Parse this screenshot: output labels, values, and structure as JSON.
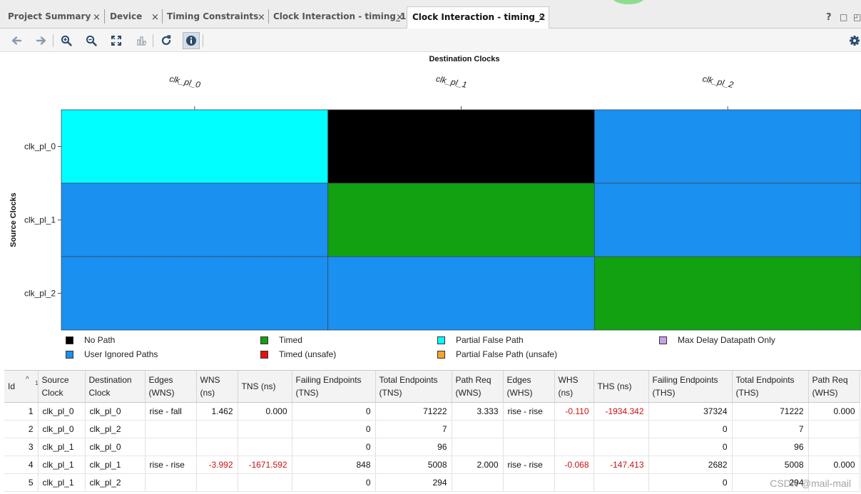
{
  "tabs": [
    {
      "label": "Project Summary",
      "active": false
    },
    {
      "label": "Device",
      "active": false
    },
    {
      "label": "Timing Constraints",
      "active": false
    },
    {
      "label": "Clock Interaction - timing_1",
      "active": false
    },
    {
      "label": "Clock Interaction - timing_2",
      "active": true
    }
  ],
  "tab_close_glyph": "×",
  "window_controls": {
    "help": "?",
    "restore": "□",
    "maximize": "◰"
  },
  "toolbar": {
    "buttons": [
      "back-icon",
      "forward-icon",
      "zoom-in-icon",
      "zoom-out-icon",
      "fit-icon",
      "chart-icon",
      "refresh-icon",
      "info-icon"
    ],
    "settings_icon": "gear-icon"
  },
  "chart_data": {
    "type": "heatmap",
    "title": "Destination Clocks",
    "xlabel": "Destination Clocks",
    "ylabel": "Source Clocks",
    "x_categories": [
      "clk_pl_0",
      "clk_pl_1",
      "clk_pl_2"
    ],
    "y_categories": [
      "clk_pl_0",
      "clk_pl_1",
      "clk_pl_2"
    ],
    "cells": [
      [
        "Partial False Path",
        "No Path",
        "User Ignored Paths"
      ],
      [
        "User Ignored Paths",
        "Timed",
        "User Ignored Paths"
      ],
      [
        "User Ignored Paths",
        "User Ignored Paths",
        "Timed"
      ]
    ],
    "legend": [
      {
        "label": "No Path",
        "color": "#000000"
      },
      {
        "label": "Timed",
        "color": "#11a111"
      },
      {
        "label": "Partial False Path",
        "color": "#00ffff"
      },
      {
        "label": "Max Delay Datapath Only",
        "color": "#c8a0e8"
      },
      {
        "label": "User Ignored Paths",
        "color": "#1a90f0"
      },
      {
        "label": "Timed (unsafe)",
        "color": "#e81010"
      },
      {
        "label": "Partial False Path (unsafe)",
        "color": "#f7a42a"
      }
    ],
    "legend_placement": "bottom"
  },
  "table": {
    "columns": [
      [
        "Id",
        ""
      ],
      [
        "Source",
        "Clock"
      ],
      [
        "Destination",
        "Clock"
      ],
      [
        "Edges",
        "(WNS)"
      ],
      [
        "WNS",
        "(ns)"
      ],
      [
        "TNS (ns)",
        ""
      ],
      [
        "Failing Endpoints",
        "(TNS)"
      ],
      [
        "Total Endpoints",
        "(TNS)"
      ],
      [
        "Path Req",
        "(WNS)"
      ],
      [
        "Edges",
        "(WHS)"
      ],
      [
        "WHS",
        "(ns)"
      ],
      [
        "THS (ns)",
        ""
      ],
      [
        "Failing Endpoints",
        "(THS)"
      ],
      [
        "Total Endpoints",
        "(THS)"
      ],
      [
        "Path Req",
        "(WHS)"
      ]
    ],
    "sort_indicator": "1",
    "rows": [
      [
        "1",
        "clk_pl_0",
        "clk_pl_0",
        "rise - fall",
        "1.462",
        "0.000",
        "0",
        "71222",
        "3.333",
        "rise - rise",
        "-0.110",
        "-1934.342",
        "37324",
        "71222",
        "0.000"
      ],
      [
        "2",
        "clk_pl_0",
        "clk_pl_2",
        "",
        "",
        "",
        "0",
        "7",
        "",
        "",
        "",
        "",
        "0",
        "7",
        ""
      ],
      [
        "3",
        "clk_pl_1",
        "clk_pl_0",
        "",
        "",
        "",
        "0",
        "96",
        "",
        "",
        "",
        "",
        "0",
        "96",
        ""
      ],
      [
        "4",
        "clk_pl_1",
        "clk_pl_1",
        "rise - rise",
        "-3.992",
        "-1671.592",
        "848",
        "5008",
        "2.000",
        "rise - rise",
        "-0.068",
        "-147.413",
        "2682",
        "5008",
        "0.000"
      ],
      [
        "5",
        "clk_pl_1",
        "clk_pl_2",
        "",
        "",
        "",
        "0",
        "294",
        "",
        "",
        "",
        "",
        "0",
        "294",
        ""
      ]
    ]
  },
  "watermark": "CSDN @mail-mail"
}
